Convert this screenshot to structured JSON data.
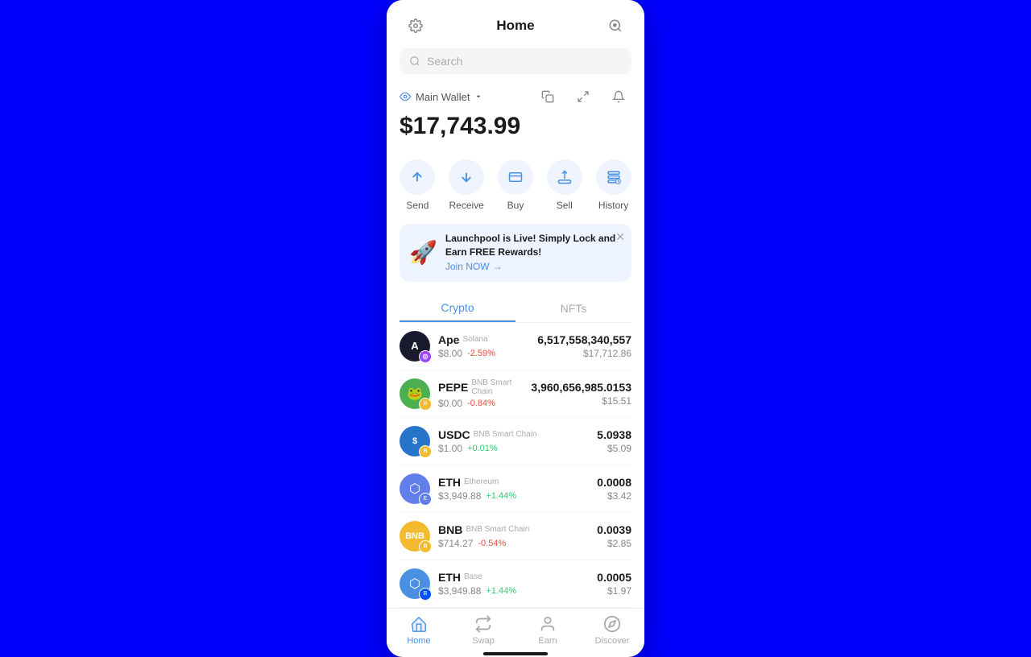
{
  "header": {
    "title": "Home",
    "settings_icon": "⚙",
    "scan_icon": "⊙"
  },
  "search": {
    "placeholder": "Search"
  },
  "wallet": {
    "name": "Main Wallet",
    "balance": "$17,743.99",
    "copy_icon": "⧉",
    "expand_icon": "⛶",
    "bell_icon": "🔔"
  },
  "actions": [
    {
      "id": "send",
      "label": "Send",
      "icon": "↑"
    },
    {
      "id": "receive",
      "label": "Receive",
      "icon": "↓"
    },
    {
      "id": "buy",
      "label": "Buy",
      "icon": "⬛"
    },
    {
      "id": "sell",
      "label": "Sell",
      "icon": "🏛"
    },
    {
      "id": "history",
      "label": "History",
      "icon": "🗂"
    }
  ],
  "banner": {
    "icon": "🚀",
    "title": "Launchpool is Live! Simply Lock and Earn FREE Rewards!",
    "link_text": "Join NOW",
    "link_arrow": "→"
  },
  "tabs": [
    {
      "id": "crypto",
      "label": "Crypto",
      "active": true
    },
    {
      "id": "nfts",
      "label": "NFTs",
      "active": false
    }
  ],
  "assets": [
    {
      "id": "ape",
      "name": "Ape",
      "chain": "Solana",
      "price": "$8.00",
      "change": "-2.59%",
      "change_type": "negative",
      "amount": "6,517,558,340,557",
      "usd": "$17,712.86"
    },
    {
      "id": "pepe",
      "name": "PEPE",
      "chain": "BNB Smart Chain",
      "price": "$0.00",
      "change": "-0.84%",
      "change_type": "negative",
      "amount": "3,960,656,985.0153",
      "usd": "$15.51"
    },
    {
      "id": "usdc",
      "name": "USDC",
      "chain": "BNB Smart Chain",
      "price": "$1.00",
      "change": "+0.01%",
      "change_type": "positive",
      "amount": "5.0938",
      "usd": "$5.09"
    },
    {
      "id": "eth",
      "name": "ETH",
      "chain": "Ethereum",
      "price": "$3,949.88",
      "change": "+1.44%",
      "change_type": "positive",
      "amount": "0.0008",
      "usd": "$3.42"
    },
    {
      "id": "bnb",
      "name": "BNB",
      "chain": "BNB Smart Chain",
      "price": "$714.27",
      "change": "-0.54%",
      "change_type": "negative",
      "amount": "0.0039",
      "usd": "$2.85"
    },
    {
      "id": "eth-base",
      "name": "ETH",
      "chain": "Base",
      "price": "$3,949.88",
      "change": "+1.44%",
      "change_type": "positive",
      "amount": "0.0005",
      "usd": "$1.97"
    }
  ],
  "bottom_nav": [
    {
      "id": "home",
      "label": "Home",
      "icon": "⌂",
      "active": true
    },
    {
      "id": "swap",
      "label": "Swap",
      "icon": "⇄",
      "active": false
    },
    {
      "id": "earn",
      "label": "Earn",
      "icon": "👤",
      "active": false
    },
    {
      "id": "discover",
      "label": "Discover",
      "icon": "◎",
      "active": false
    }
  ]
}
